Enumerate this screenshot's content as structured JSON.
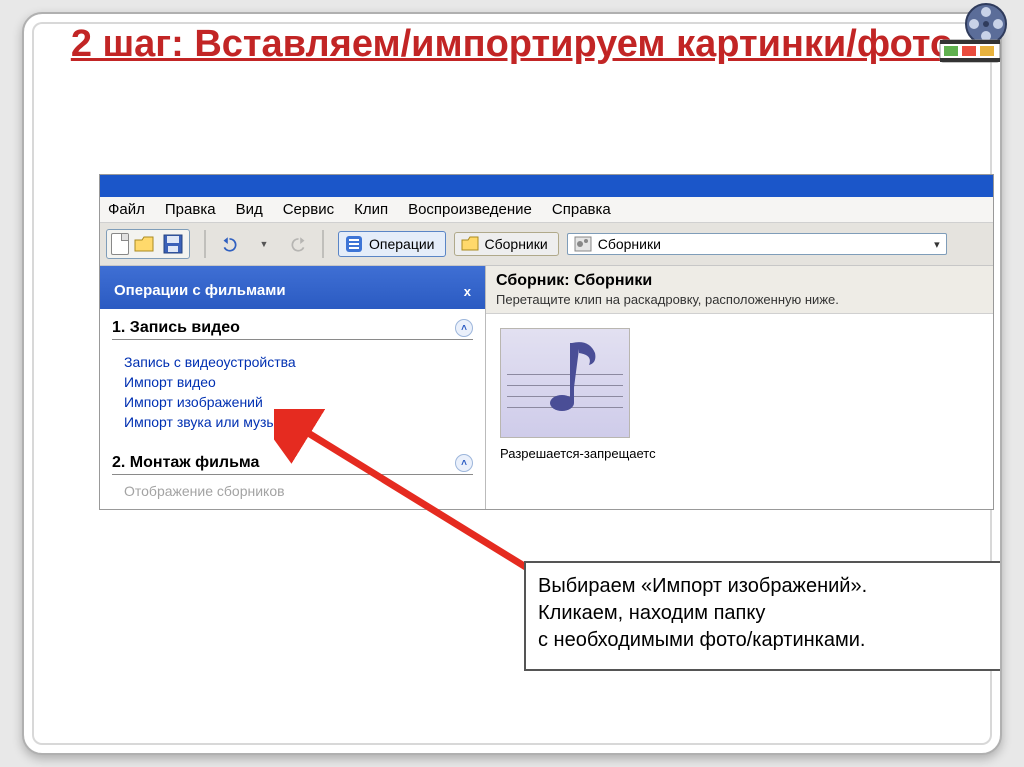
{
  "slide": {
    "title": "2 шаг: Вставляем/импортируем картинки/фото"
  },
  "menubar": {
    "file": "Файл",
    "edit": "Правка",
    "view": "Вид",
    "tools": "Сервис",
    "clip": "Клип",
    "play": "Воспроизведение",
    "help": "Справка"
  },
  "toolbar": {
    "tasks_label": "Операции",
    "collections_label": "Сборники",
    "combo_value": "Сборники"
  },
  "left_pane": {
    "header": "Операции с фильмами",
    "close": "x",
    "section1": {
      "prefix": "1.",
      "title": "Запись видео",
      "links": [
        "Запись с видеоустройства",
        "Импорт видео",
        "Импорт изображений",
        "Импорт звука или музыки"
      ]
    },
    "section2": {
      "prefix": "2.",
      "title": "Монтаж фильма",
      "disabled_link": "Отображение сборников"
    }
  },
  "right_pane": {
    "title": "Сборник: Сборники",
    "subtitle": "Перетащите клип на раскадровку, расположенную ниже.",
    "thumb_caption": "Разрешается-запрещаетс"
  },
  "callout": {
    "line1": "Выбираем «Импорт изображений».",
    "line2": "Кликаем, находим папку",
    "line3": "с необходимыми фото/картинками."
  }
}
